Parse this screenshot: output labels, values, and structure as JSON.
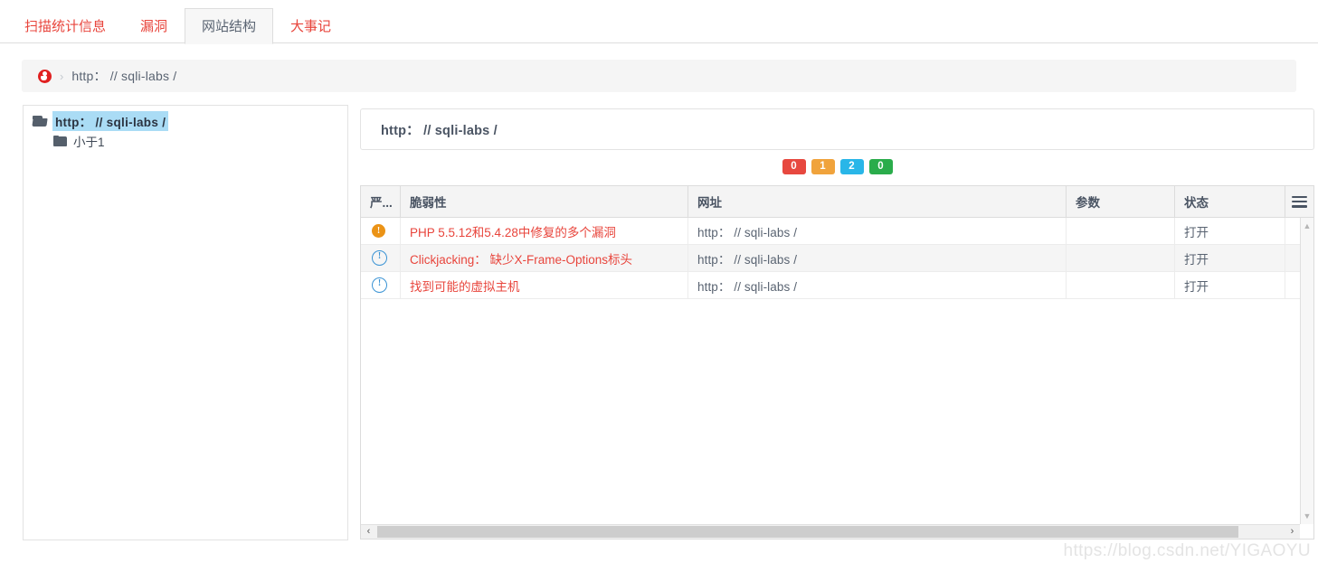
{
  "tabs": [
    {
      "label": "扫描统计信息",
      "active": false
    },
    {
      "label": "漏洞",
      "active": false
    },
    {
      "label": "网站结构",
      "active": true
    },
    {
      "label": "大事记",
      "active": false
    }
  ],
  "breadcrumb": {
    "icon": "red-globe-icon",
    "separator": "›",
    "text": "http： // sqli-labs /"
  },
  "tree": {
    "root": {
      "label": "http： // sqli-labs /",
      "icon": "folder-open-icon",
      "selected": true
    },
    "children": [
      {
        "label": "小于1",
        "icon": "folder-closed-icon",
        "selected": false
      }
    ]
  },
  "url_card": {
    "title": "http： // sqli-labs /"
  },
  "badges": [
    {
      "count": "0",
      "color": "#e7483f",
      "severity": "high"
    },
    {
      "count": "1",
      "color": "#f0a33c",
      "severity": "medium"
    },
    {
      "count": "2",
      "color": "#29b6e8",
      "severity": "low"
    },
    {
      "count": "0",
      "color": "#2aac4b",
      "severity": "info"
    }
  ],
  "table": {
    "columns": [
      {
        "label": "严...",
        "key": "severity"
      },
      {
        "label": "脆弱性",
        "key": "vulnerability"
      },
      {
        "label": "网址",
        "key": "url"
      },
      {
        "label": "参数",
        "key": "parameter"
      },
      {
        "label": "状态",
        "key": "state"
      }
    ],
    "menu_icon": "hamburger-menu-icon",
    "rows": [
      {
        "severity_icon": "medium",
        "vulnerability": "PHP 5.5.12和5.4.28中修复的多个漏洞",
        "url": "http： // sqli-labs /",
        "parameter": "",
        "state": "打开"
      },
      {
        "severity_icon": "info",
        "vulnerability": "Clickjacking： 缺少X-Frame-Options标头",
        "url": "http： // sqli-labs /",
        "parameter": "",
        "state": "打开"
      },
      {
        "severity_icon": "info",
        "vulnerability": "找到可能的虚拟主机",
        "url": "http： // sqli-labs /",
        "parameter": "",
        "state": "打开"
      }
    ]
  },
  "scrollbars": {
    "vertical_up": "▲",
    "vertical_down": "▼",
    "horizontal_left": "‹",
    "horizontal_right": "›"
  },
  "watermark": "https://blog.csdn.net/YIGAOYU"
}
